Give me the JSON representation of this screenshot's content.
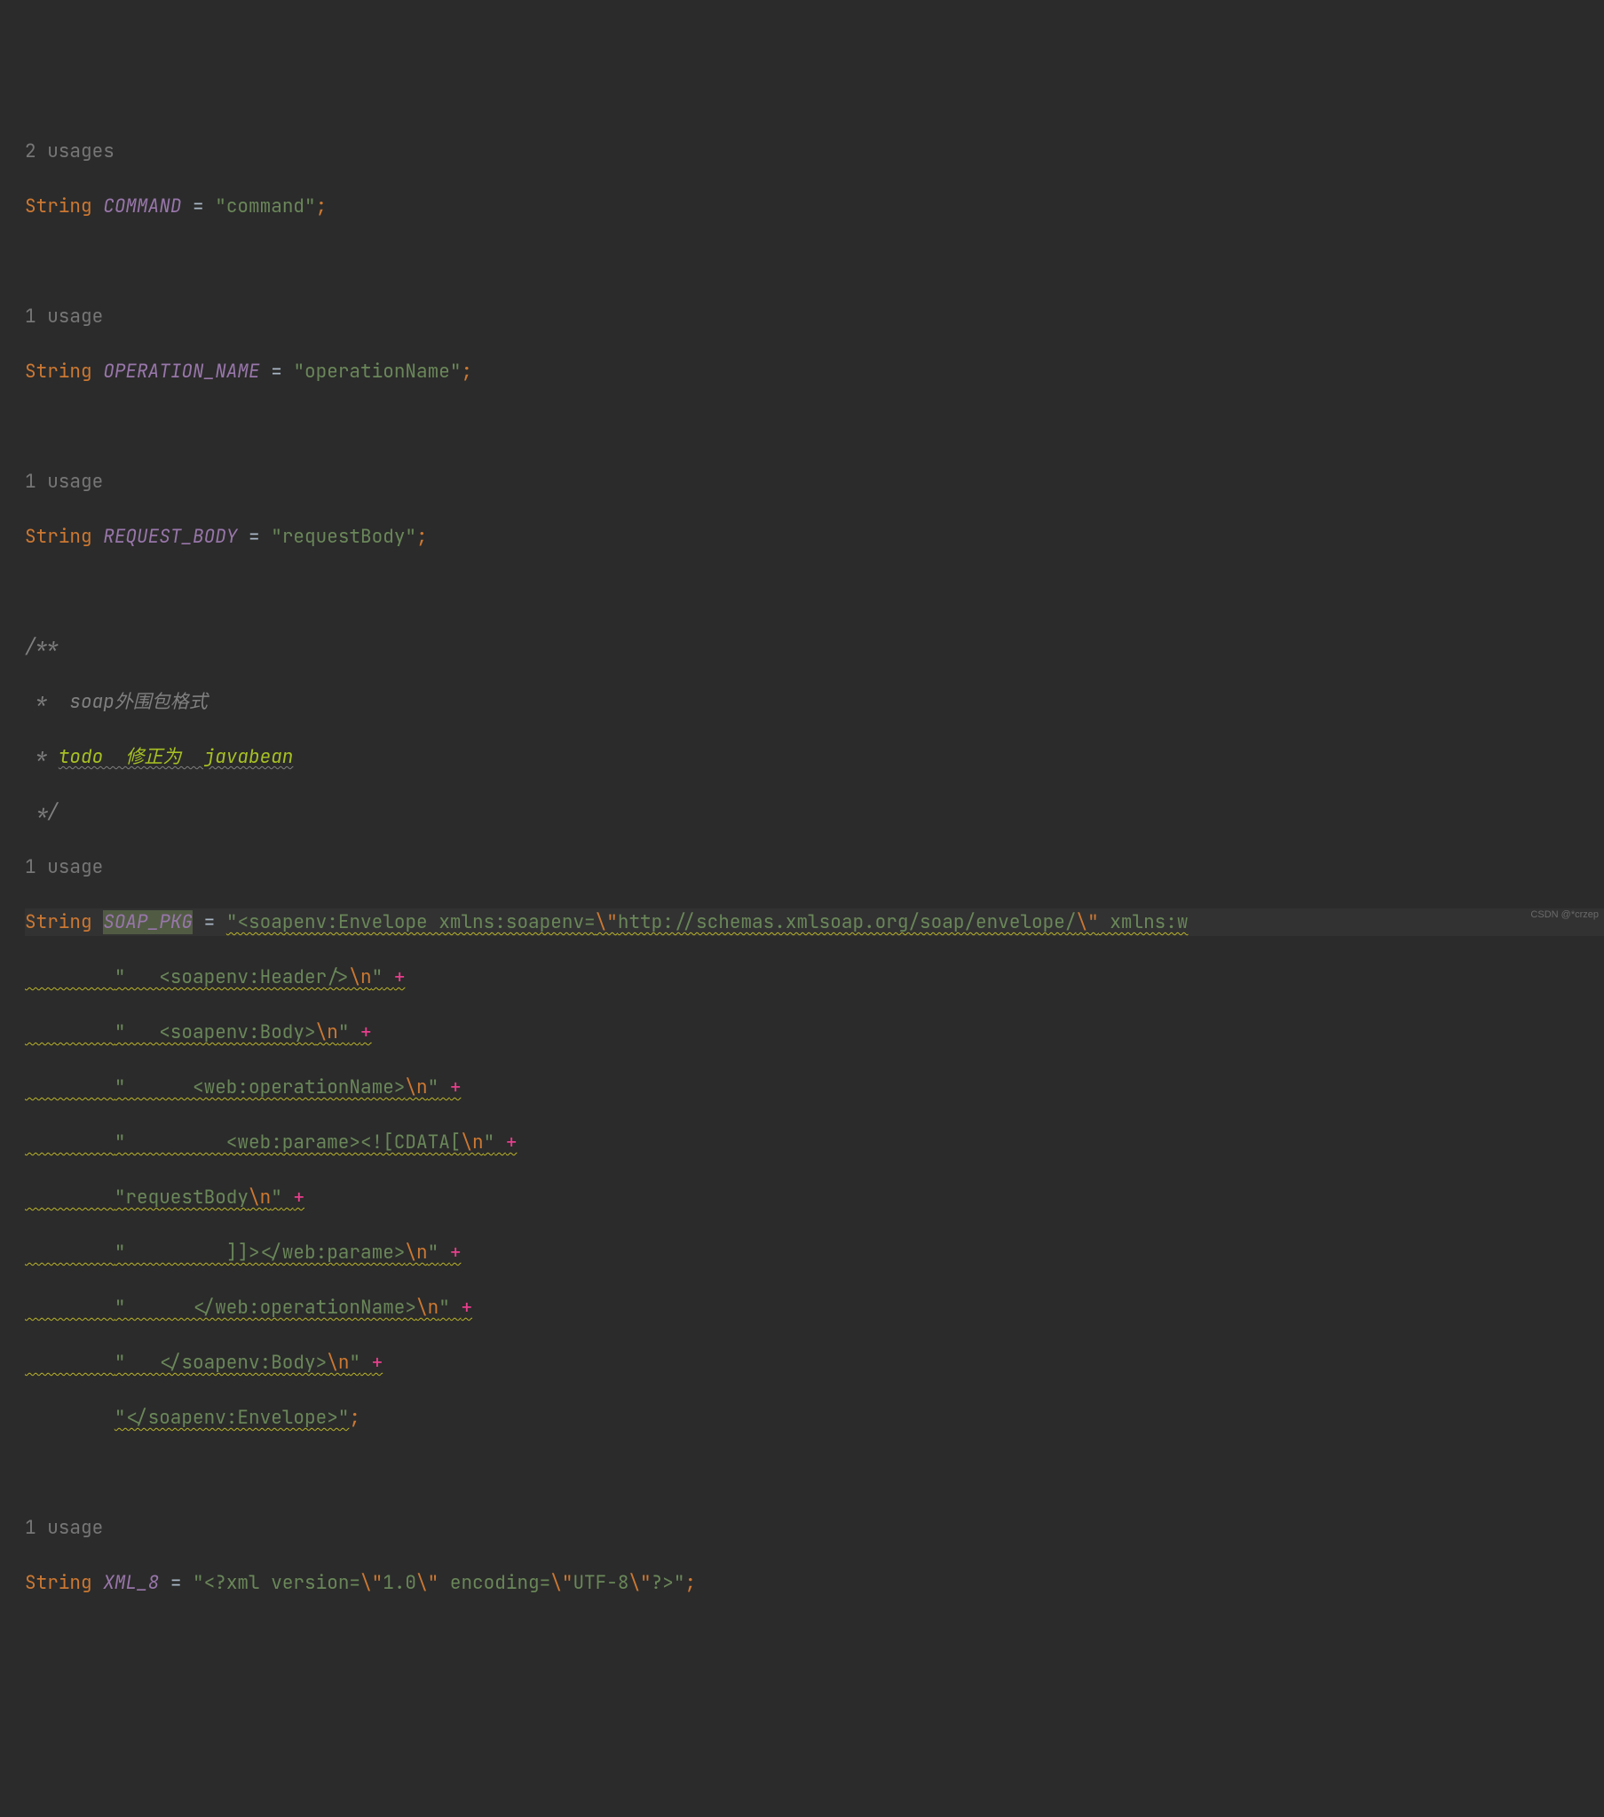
{
  "usages": {
    "u0": "2 usages",
    "u1": "1 usage",
    "u2": "1 usage",
    "u3": "1 usage",
    "u4": "1 usage"
  },
  "tokens": {
    "string_kw": "String",
    "eq": " = ",
    "semi": ";",
    "plus": "+",
    "quote": "\""
  },
  "decl_command": {
    "name": "COMMAND",
    "value": "\"command\""
  },
  "decl_operation": {
    "name": "OPERATION_NAME",
    "value": "\"operationName\""
  },
  "decl_request": {
    "name": "REQUEST_BODY",
    "value": "\"requestBody\""
  },
  "comment": {
    "open": "/**",
    "line1_pre": " *  ",
    "line1_kw": "soap",
    "line1_rest": "外围包格式",
    "line2_pre": " * ",
    "line2_todo": "todo  修正为  javabean",
    "close": " */"
  },
  "soap": {
    "name": "SOAP_PKG",
    "l1_a": "\"<soapenv:Envelope xmlns:soapenv=",
    "l1_esc1": "\\\"",
    "l1_url": "http://schemas.xmlsoap.org/soap/envelope/",
    "l1_esc2": "\\\"",
    "l1_b": " xmlns:w",
    "l2_a": "\"   <soapenv:Header/>",
    "l2_esc": "\\n",
    "l2_b": "\"",
    "l3_a": "\"   <soapenv:Body>",
    "l3_esc": "\\n",
    "l3_b": "\"",
    "l4_a": "\"      <web:operationName>",
    "l4_esc": "\\n",
    "l4_b": "\"",
    "l5_a": "\"         <web:parame><![CDATA[",
    "l5_esc": "\\n",
    "l5_b": "\"",
    "l6_a": "\"requestBody",
    "l6_esc": "\\n",
    "l6_b": "\"",
    "l7_a": "\"         ]]></web:parame>",
    "l7_esc": "\\n",
    "l7_b": "\"",
    "l8_a": "\"      </web:operationName>",
    "l8_esc": "\\n",
    "l8_b": "\"",
    "l9_a": "\"   </soapenv:Body>",
    "l9_esc": "\\n",
    "l9_b": "\"",
    "l10": "\"</soapenv:Envelope>\""
  },
  "xml8": {
    "name": "XML_8",
    "a": "\"<?xml version=",
    "esc1": "\\\"",
    "b": "1.0",
    "esc2": "\\\"",
    "c": " encoding=",
    "esc3": "\\\"",
    "d": "UTF-8",
    "esc4": "\\\"",
    "e": "?>\""
  },
  "watermark": "CSDN @*crzep"
}
